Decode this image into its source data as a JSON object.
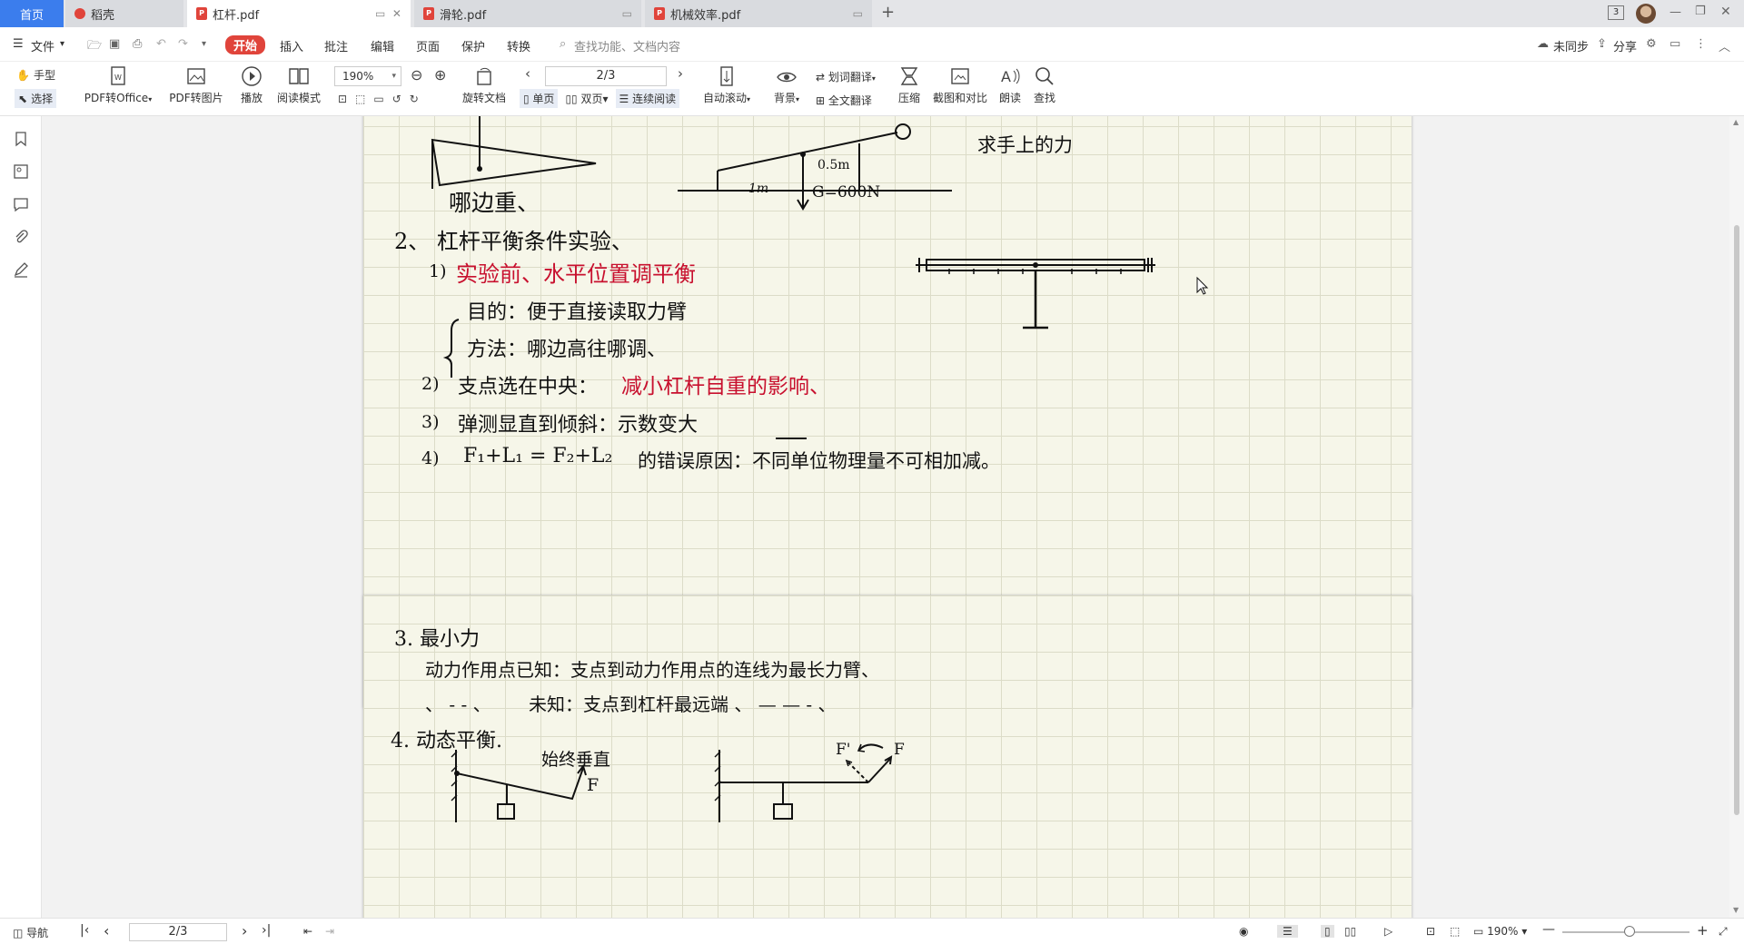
{
  "tabs": {
    "home": "首页",
    "t1": "稻壳",
    "t2": "杠杆.pdf",
    "t3": "滑轮.pdf",
    "t4": "机械效率.pdf",
    "new": "+"
  },
  "window": {
    "badge": "3"
  },
  "menu": {
    "file": "文件",
    "start": "开始",
    "insert": "插入",
    "annotate": "批注",
    "edit": "编辑",
    "page": "页面",
    "protect": "保护",
    "convert": "转换",
    "search_placeholder": "查找功能、文档内容",
    "sync": "未同步",
    "share": "分享"
  },
  "toolbar": {
    "hand": "手型",
    "select": "选择",
    "pdf_office": "PDF转Office",
    "pdf_image": "PDF转图片",
    "play": "播放",
    "read_mode": "阅读模式",
    "zoom": "190%",
    "rotate": "旋转文档",
    "page_input": "2/3",
    "single": "单页",
    "double": "双页",
    "continuous": "连续阅读",
    "auto_scroll": "自动滚动",
    "background": "背景",
    "word_translate": "划词翻译",
    "full_translate": "全文翻译",
    "compress": "压缩",
    "screenshot_compare": "截图和对比",
    "read_aloud": "朗读",
    "find": "查找"
  },
  "page1": {
    "note_hand": "求手上的力",
    "dim_05": "0.5m",
    "dim_1": "1m",
    "weight": "G=600N",
    "which_heavy": "哪边重、",
    "item2": "2、 杠杆平衡条件实验、",
    "s1_num": "1)",
    "s1": "实验前、水平位置调平衡",
    "purpose": "目的：便于直接读取力臂",
    "method": "方法：哪边高往哪调、",
    "s2_num": "2)",
    "s2a": "支点选在中央：",
    "s2b": "减小杠杆自重的影响、",
    "s3_num": "3)",
    "s3": "弹测显直到倾斜：示数变大",
    "s4_num": "4)",
    "s4a": "F₁+L₁ = F₂+L₂",
    "s4b": "的错误原因：不同单位物理量不可相加减。"
  },
  "page2": {
    "item3": "3. 最小力",
    "l1": "动力作用点已知：支点到动力作用点的连线为最长力臂、",
    "l2a": "、 - - 、",
    "l2b": "未知：支点到杠杆最远端 、 — — - 、",
    "item4": "4. 动态平衡.",
    "always_vertical": "始终垂直",
    "F1": "F",
    "Fp": "F'",
    "F2": "F"
  },
  "status": {
    "nav": "导航",
    "page_input": "2/3",
    "zoom": "190%"
  }
}
